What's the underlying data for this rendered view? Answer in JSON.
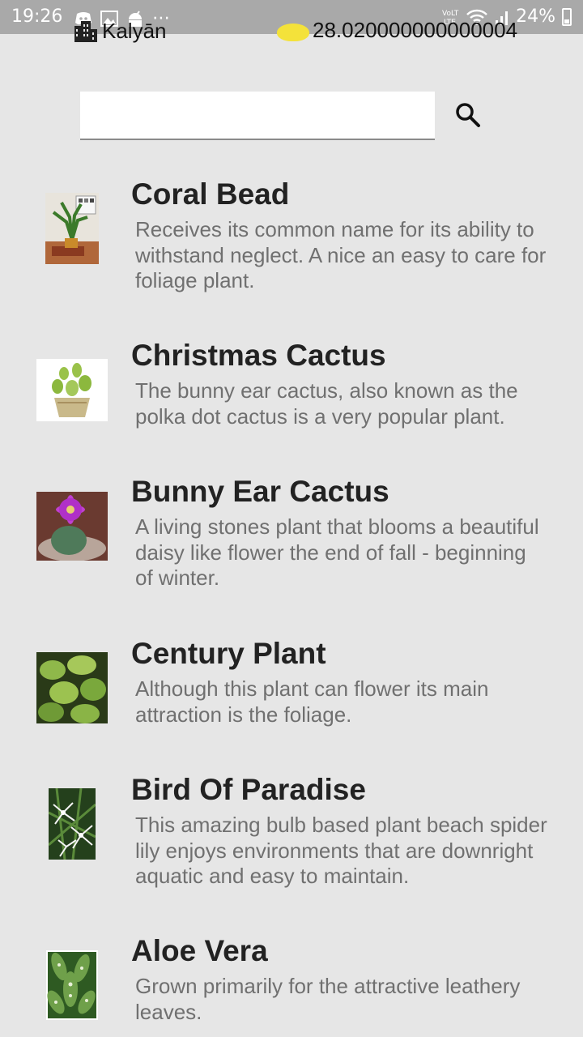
{
  "status_bar": {
    "time": "19:26",
    "battery": "24%"
  },
  "header": {
    "location": "Kalyān",
    "temperature": "28.020000000000004"
  },
  "search": {
    "placeholder": "",
    "value": ""
  },
  "plants": [
    {
      "name": "Coral Bead",
      "description": "Receives its common name for its ability to withstand neglect. A nice an easy to care for foliage plant.",
      "image": "potted-plant-on-table"
    },
    {
      "name": "Christmas Cactus",
      "description": "The bunny ear cactus, also known as the polka dot cactus is a very popular plant.",
      "image": "bunny-ear-cactus-pot"
    },
    {
      "name": "Bunny Ear Cactus",
      "description": "A living stones plant that blooms a beautiful daisy like flower the end of fall - beginning of winter.",
      "image": "purple-flower-succulent"
    },
    {
      "name": "Century Plant",
      "description": "Although this plant can flower its main attraction is the foliage.",
      "image": "green-foliage"
    },
    {
      "name": "Bird Of Paradise",
      "description": "This amazing bulb based plant beach spider lily enjoys environments that are downright aquatic and easy to maintain.",
      "image": "spider-lily"
    },
    {
      "name": "Aloe Vera",
      "description": "Grown primarily for the attractive leathery leaves.",
      "image": "variegated-leaves"
    }
  ]
}
